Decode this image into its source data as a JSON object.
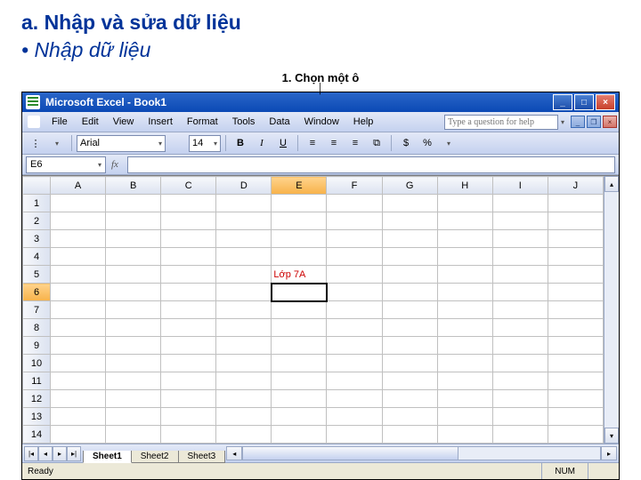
{
  "slide": {
    "heading_a": "a. Nhập và sửa dữ liệu",
    "heading_b": "• Nhập dữ liệu",
    "annotation": "1. Chọn một ô"
  },
  "window": {
    "title": "Microsoft Excel - Book1",
    "min": "_",
    "max": "□",
    "close": "×"
  },
  "menu": {
    "file": "File",
    "edit": "Edit",
    "view": "View",
    "insert": "Insert",
    "format": "Format",
    "tools": "Tools",
    "data": "Data",
    "window": "Window",
    "help": "Help"
  },
  "helpbox": {
    "placeholder": "Type a question for help"
  },
  "toolbar": {
    "font": "Arial",
    "size": "14",
    "bold": "B",
    "italic": "I",
    "underline": "U",
    "percent": "%",
    "currency": "$"
  },
  "namebox": "E6",
  "columns": [
    "A",
    "B",
    "C",
    "D",
    "E",
    "F",
    "G",
    "H",
    "I",
    "J"
  ],
  "rows": [
    "1",
    "2",
    "3",
    "4",
    "5",
    "6",
    "7",
    "8",
    "9",
    "10",
    "11",
    "12",
    "13",
    "14"
  ],
  "selected_row": "6",
  "selected_col_index": 4,
  "active_cell": {
    "row": "6",
    "col": "E"
  },
  "cell_data": {
    "E5": "Lớp 7A"
  },
  "sheets": {
    "s1": "Sheet1",
    "s2": "Sheet2",
    "s3": "Sheet3"
  },
  "status": {
    "ready": "Ready",
    "num": "NUM"
  }
}
